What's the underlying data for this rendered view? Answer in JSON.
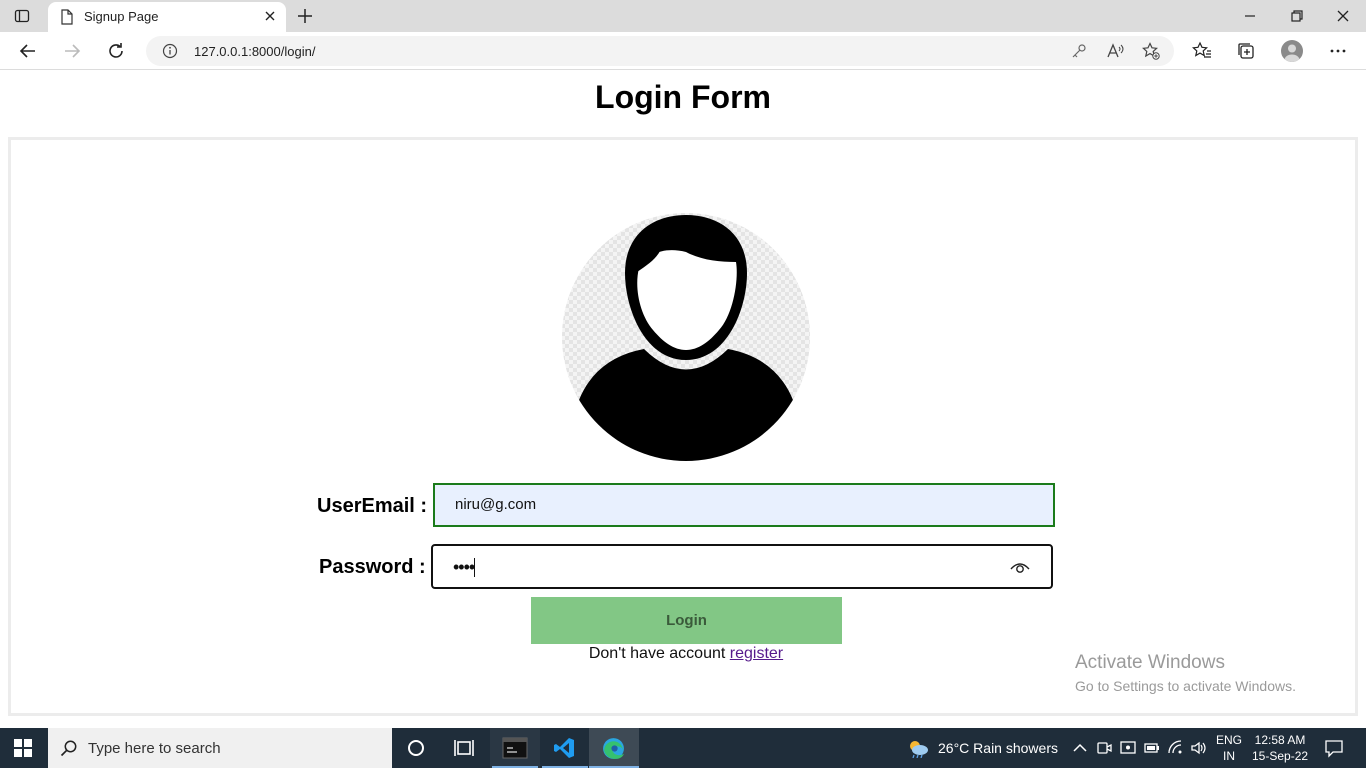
{
  "browser": {
    "tab_title": "Signup Page",
    "url": "127.0.0.1:8000/login/"
  },
  "page": {
    "title": "Login Form",
    "email_label": "UserEmail :",
    "email_value": "niru@g.com",
    "password_label": "Password :",
    "password_mask": "••••",
    "login_button": "Login",
    "register_prompt": "Don't have account",
    "register_link": "register"
  },
  "watermark": {
    "line1": "Activate Windows",
    "line2": "Go to Settings to activate Windows."
  },
  "taskbar": {
    "search_placeholder": "Type here to search",
    "weather": "26°C  Rain showers",
    "lang_line1": "ENG",
    "lang_line2": "IN",
    "time": "12:58 AM",
    "date": "15-Sep-22"
  },
  "colors": {
    "login_button_bg": "#82c785",
    "email_border": "#1b7b1b",
    "email_autofill_bg": "#e8f0fe",
    "taskbar_bg": "#1f2d3a"
  }
}
